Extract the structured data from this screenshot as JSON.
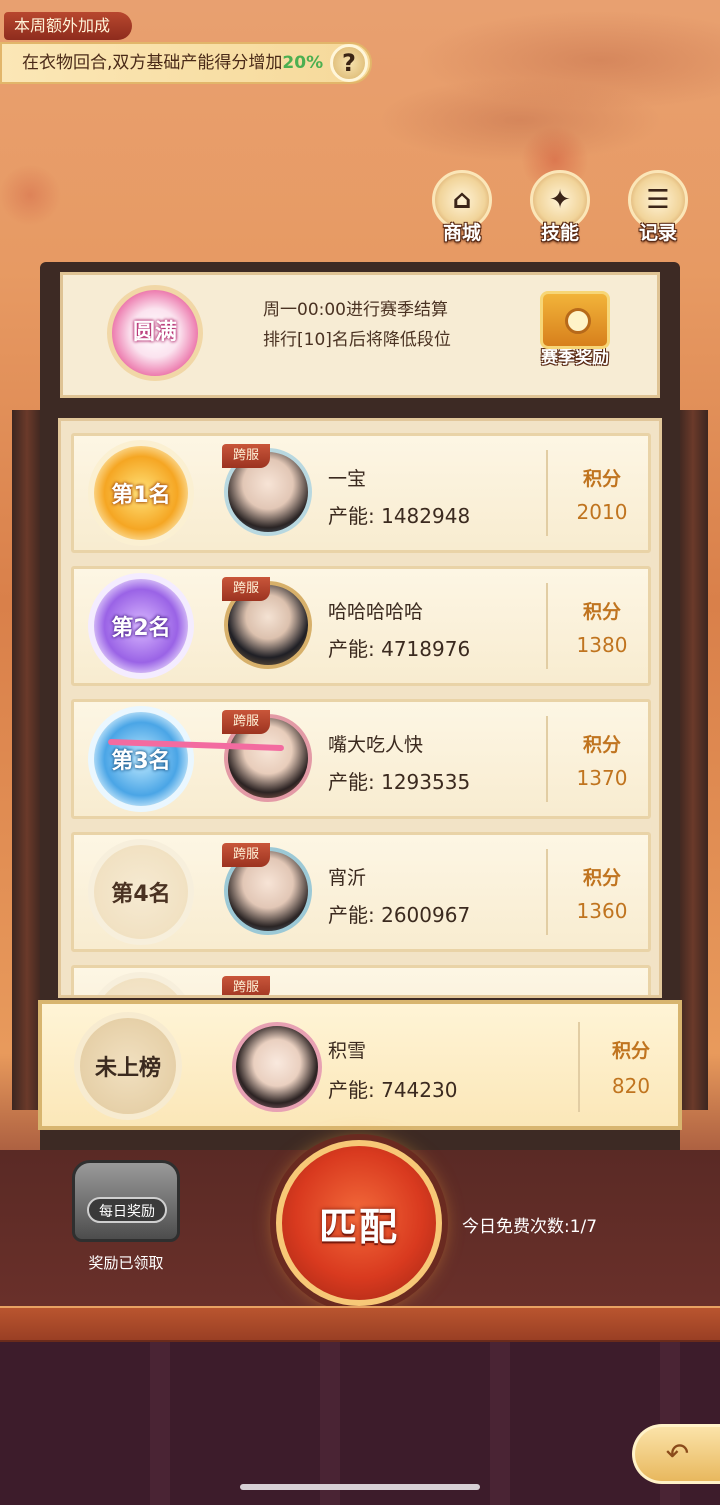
{
  "bonus": {
    "tag": "本周额外加成",
    "text": "在衣物回合,双方基础产能得分增加",
    "percent": "20%",
    "help_icon": "?"
  },
  "nav": {
    "shop": "商城",
    "skill": "技能",
    "record": "记录"
  },
  "season": {
    "badge": "圆满",
    "line1": "周一00:00进行赛季结算",
    "line2": "排行[10]名后将降低段位",
    "reward_label": "赛季奖励"
  },
  "ranking": {
    "cross_server_tag": "跨服",
    "power_prefix": "产能: ",
    "score_label": "积分",
    "rows": [
      {
        "rank": "第1名",
        "name": "一宝",
        "power": "1482948",
        "score": "2010"
      },
      {
        "rank": "第2名",
        "name": "哈哈哈哈哈",
        "power": "4718976",
        "score": "1380"
      },
      {
        "rank": "第3名",
        "name": "嘴大吃人快",
        "power": "1293535",
        "score": "1370"
      },
      {
        "rank": "第4名",
        "name": "宵沂",
        "power": "2600967",
        "score": "1360"
      }
    ]
  },
  "me": {
    "rank": "未上榜",
    "name": "积雪",
    "power": "744230",
    "score_label": "积分",
    "score": "820"
  },
  "bottom": {
    "daily_label": "每日奖励",
    "daily_status": "奖励已领取",
    "match": "匹配",
    "free_count": "今日免费次数:1/7"
  },
  "colors": {
    "accent_score": "#c0741f",
    "bonus_percent": "#4caf50",
    "match_button": "#d93a1f"
  }
}
